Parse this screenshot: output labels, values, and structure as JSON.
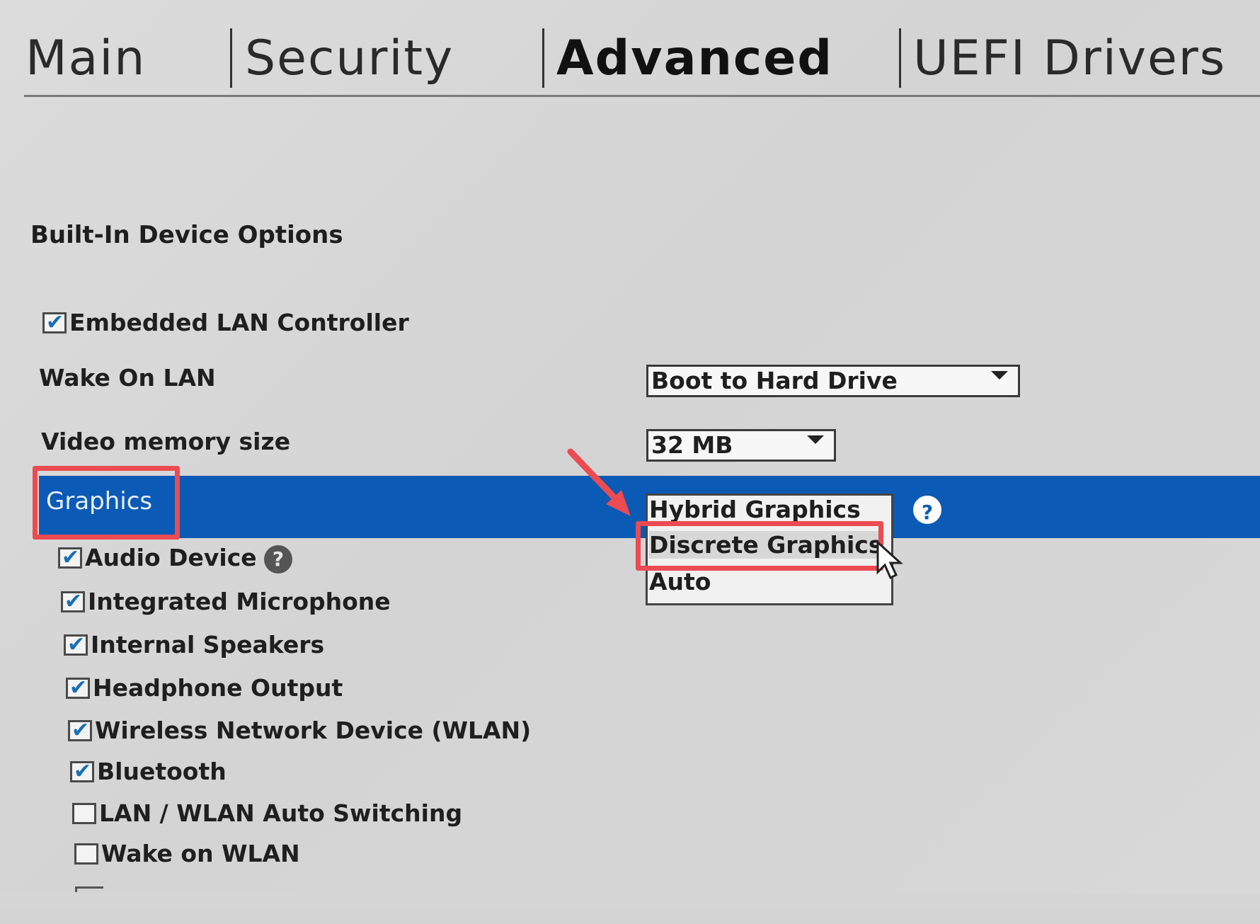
{
  "tabs": [
    {
      "label": "Main",
      "active": false
    },
    {
      "label": "Security",
      "active": false
    },
    {
      "label": "Advanced",
      "active": true
    },
    {
      "label": "UEFI Drivers",
      "active": false
    }
  ],
  "section": {
    "title": "Built-In Device Options"
  },
  "settings": {
    "embedded_lan": {
      "label": "Embedded LAN Controller",
      "checked": true
    },
    "wake_on_lan": {
      "label": "Wake On LAN",
      "value": "Boot to Hard Drive"
    },
    "video_memory": {
      "label": "Video memory size",
      "value": "32 MB"
    },
    "graphics": {
      "label": "Graphics",
      "options": [
        "Hybrid Graphics",
        "Discrete Graphics",
        "Auto"
      ],
      "highlighted_option": "Discrete Graphics"
    },
    "audio_device": {
      "label": "Audio Device",
      "checked": true
    },
    "integrated_microphone": {
      "label": "Integrated Microphone",
      "checked": true
    },
    "internal_speakers": {
      "label": "Internal Speakers",
      "checked": true
    },
    "headphone_output": {
      "label": "Headphone Output",
      "checked": true
    },
    "wlan": {
      "label": "Wireless Network Device (WLAN)",
      "checked": true
    },
    "bluetooth": {
      "label": "Bluetooth",
      "checked": true
    },
    "lan_wlan_switching": {
      "label": "LAN / WLAN Auto Switching",
      "checked": false
    },
    "wake_on_wlan": {
      "label": "Wake on WLAN",
      "checked": false
    }
  },
  "icons": {
    "help": "?",
    "help_icon_name": "help-icon"
  },
  "colors": {
    "selection_band": "#0b5ab5",
    "annotation": "#ec4b52",
    "checkmark": "#1a6fb5"
  }
}
